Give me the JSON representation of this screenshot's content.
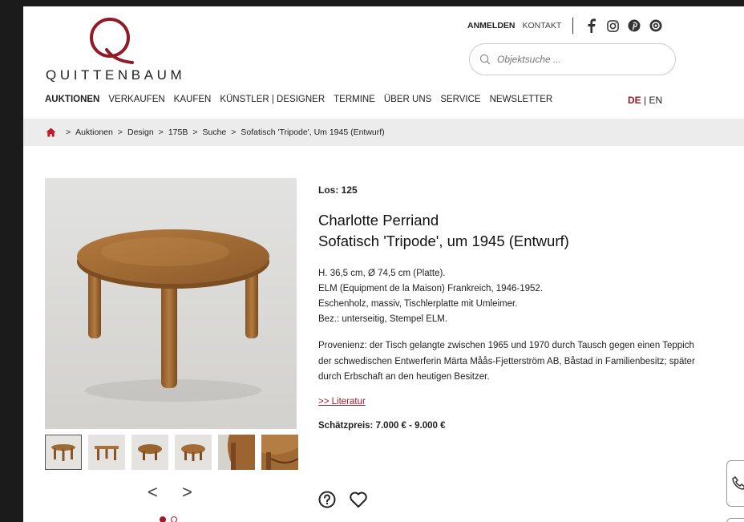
{
  "brand": {
    "name": "QUITTENBAUM",
    "color": "#8e1b26"
  },
  "topnav": {
    "login": "ANMELDEN",
    "contact": "KONTAKT",
    "social": [
      "facebook-icon",
      "instagram-icon",
      "pinterest-icon",
      "vimeo-icon"
    ]
  },
  "search": {
    "placeholder": "Objektsuche ..."
  },
  "mainnav": {
    "items": [
      "AUKTIONEN",
      "VERKAUFEN",
      "KAUFEN",
      "KÜNSTLER | DESIGNER",
      "TERMINE",
      "ÜBER UNS",
      "SERVICE",
      "NEWSLETTER"
    ],
    "active": "AUKTIONEN"
  },
  "lang": {
    "de": "DE",
    "sep": "|",
    "en": "EN"
  },
  "breadcrumb": {
    "sep": ">",
    "items": [
      "Auktionen",
      "Design",
      "175B",
      "Suche",
      "Sofatisch 'Tripode', Um 1945 (Entwurf)"
    ]
  },
  "gallery": {
    "thumbnails": 6,
    "selected": 0,
    "prev": "<",
    "next": ">"
  },
  "lot": {
    "number": "Los: 125",
    "artist": "Charlotte Perriand",
    "title": "Sofatisch 'Tripode', um 1945 (Entwurf)",
    "specs": [
      "H. 36,5 cm, Ø 74,5 cm (Platte).",
      "ELM (Equipment de la Maison) Frankreich, 1946-1952.",
      "Eschenholz, massiv, Tischlerplatte mit Umleimer.",
      "Bez.: unterseitig, Stempel ELM."
    ],
    "provenance": "Provenienz: der Tisch gelangte zwischen 1965 und 1970 durch Tausch gegen einen Teppich der schwedischen Entwerferin Märta Måås-Fjetterström AB, Båstad in Familienbesitz; später durch Erbschaft an den heutigen Besitzer.",
    "literature_link": ">> Literatur",
    "estimate": "Schätzpreis: 7.000 € - 9.000 €"
  },
  "actions": [
    "question-icon",
    "heart-icon"
  ]
}
